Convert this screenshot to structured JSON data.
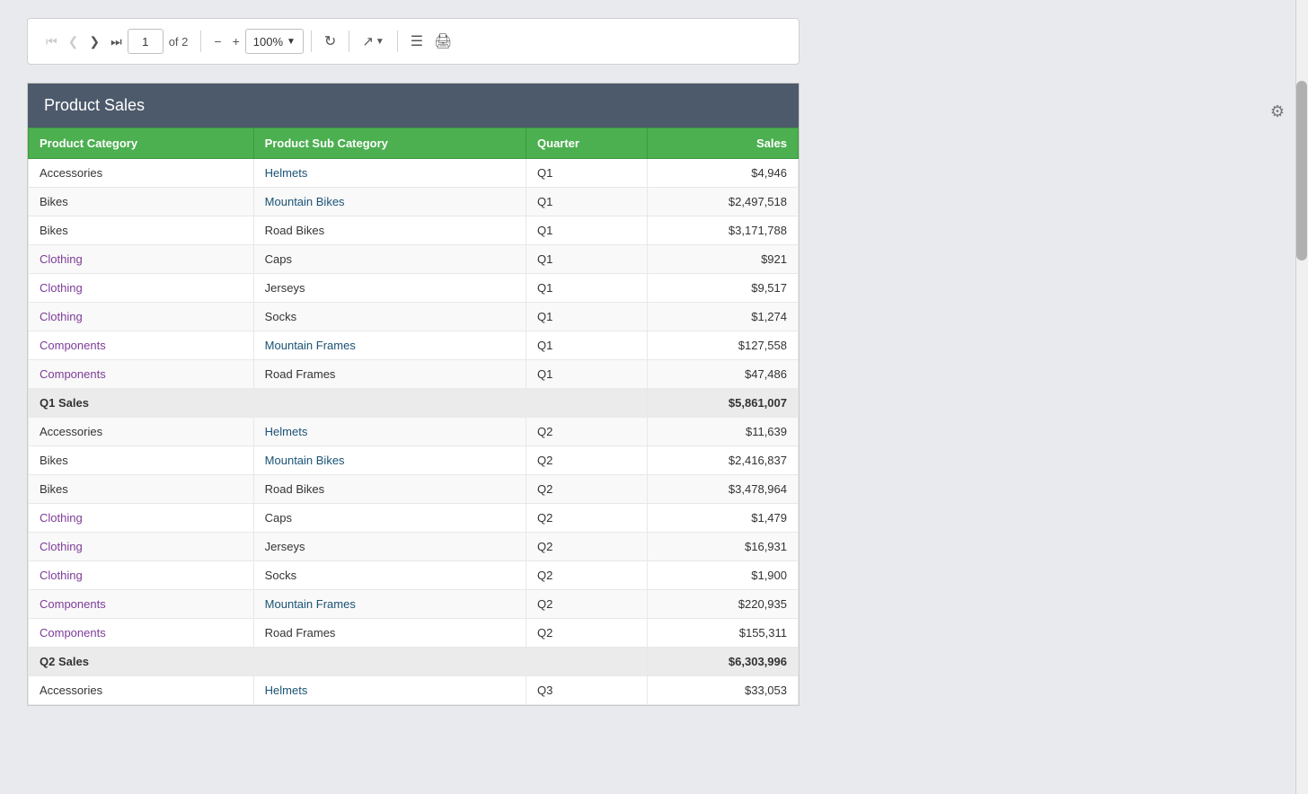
{
  "toolbar": {
    "page_input_value": "1",
    "page_of_label": "of 2",
    "zoom_value": "100%",
    "first_page_label": "⏮",
    "prev_page_label": "‹",
    "next_page_label": "›",
    "last_page_label": "⏭",
    "zoom_out_label": "−",
    "zoom_in_label": "+",
    "refresh_label": "↺",
    "export_label": "↗",
    "page_layout_label": "☰",
    "print_label": "🖨"
  },
  "report": {
    "title": "Product Sales",
    "columns": [
      {
        "label": "Product Category",
        "key": "category"
      },
      {
        "label": "Product Sub Category",
        "key": "subcategory"
      },
      {
        "label": "Quarter",
        "key": "quarter"
      },
      {
        "label": "Sales",
        "key": "sales"
      }
    ],
    "rows": [
      {
        "category": "Accessories",
        "subcategory": "Helmets",
        "quarter": "Q1",
        "sales": "$4,946",
        "cat_type": "plain",
        "sub_type": "blue"
      },
      {
        "category": "Bikes",
        "subcategory": "Mountain Bikes",
        "quarter": "Q1",
        "sales": "$2,497,518",
        "cat_type": "plain",
        "sub_type": "blue"
      },
      {
        "category": "Bikes",
        "subcategory": "Road Bikes",
        "quarter": "Q1",
        "sales": "$3,171,788",
        "cat_type": "plain",
        "sub_type": "plain"
      },
      {
        "category": "Clothing",
        "subcategory": "Caps",
        "quarter": "Q1",
        "sales": "$921",
        "cat_type": "purple",
        "sub_type": "plain"
      },
      {
        "category": "Clothing",
        "subcategory": "Jerseys",
        "quarter": "Q1",
        "sales": "$9,517",
        "cat_type": "purple",
        "sub_type": "plain"
      },
      {
        "category": "Clothing",
        "subcategory": "Socks",
        "quarter": "Q1",
        "sales": "$1,274",
        "cat_type": "purple",
        "sub_type": "plain"
      },
      {
        "category": "Components",
        "subcategory": "Mountain Frames",
        "quarter": "Q1",
        "sales": "$127,558",
        "cat_type": "purple",
        "sub_type": "blue"
      },
      {
        "category": "Components",
        "subcategory": "Road Frames",
        "quarter": "Q1",
        "sales": "$47,486",
        "cat_type": "purple",
        "sub_type": "plain"
      },
      {
        "category": "Q1 Sales",
        "subcategory": "",
        "quarter": "",
        "sales": "$5,861,007",
        "subtotal": true
      },
      {
        "category": "Accessories",
        "subcategory": "Helmets",
        "quarter": "Q2",
        "sales": "$11,639",
        "cat_type": "plain",
        "sub_type": "blue"
      },
      {
        "category": "Bikes",
        "subcategory": "Mountain Bikes",
        "quarter": "Q2",
        "sales": "$2,416,837",
        "cat_type": "plain",
        "sub_type": "blue"
      },
      {
        "category": "Bikes",
        "subcategory": "Road Bikes",
        "quarter": "Q2",
        "sales": "$3,478,964",
        "cat_type": "plain",
        "sub_type": "plain"
      },
      {
        "category": "Clothing",
        "subcategory": "Caps",
        "quarter": "Q2",
        "sales": "$1,479",
        "cat_type": "purple",
        "sub_type": "plain"
      },
      {
        "category": "Clothing",
        "subcategory": "Jerseys",
        "quarter": "Q2",
        "sales": "$16,931",
        "cat_type": "purple",
        "sub_type": "plain"
      },
      {
        "category": "Clothing",
        "subcategory": "Socks",
        "quarter": "Q2",
        "sales": "$1,900",
        "cat_type": "purple",
        "sub_type": "plain"
      },
      {
        "category": "Components",
        "subcategory": "Mountain Frames",
        "quarter": "Q2",
        "sales": "$220,935",
        "cat_type": "purple",
        "sub_type": "blue"
      },
      {
        "category": "Components",
        "subcategory": "Road Frames",
        "quarter": "Q2",
        "sales": "$155,311",
        "cat_type": "purple",
        "sub_type": "plain"
      },
      {
        "category": "Q2 Sales",
        "subcategory": "",
        "quarter": "",
        "sales": "$6,303,996",
        "subtotal": true
      },
      {
        "category": "Accessories",
        "subcategory": "Helmets",
        "quarter": "Q3",
        "sales": "$33,053",
        "cat_type": "plain",
        "sub_type": "blue",
        "partial": true
      }
    ]
  },
  "gear_icon": "⚙"
}
